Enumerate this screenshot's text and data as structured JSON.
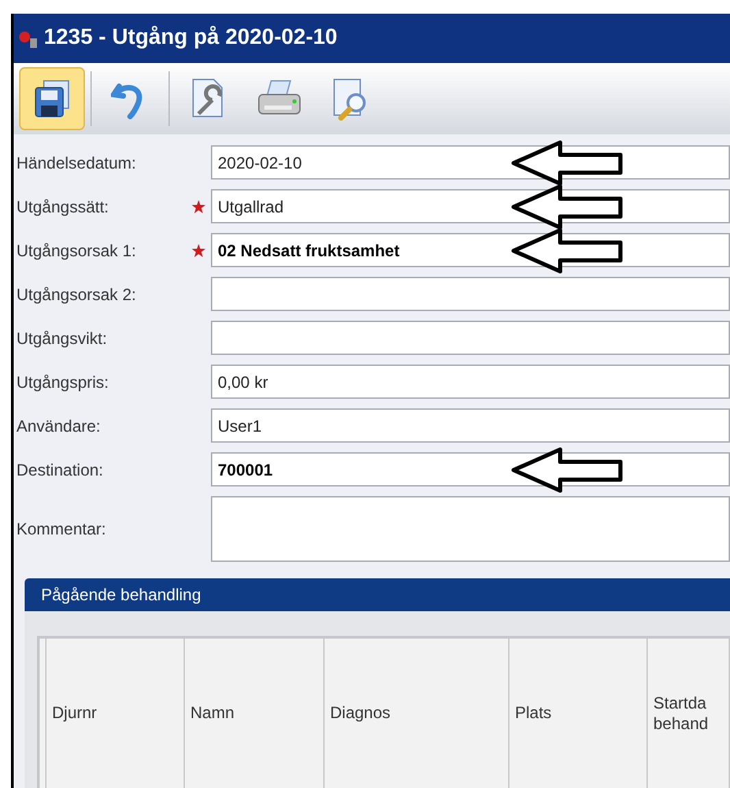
{
  "window": {
    "title": "1235 - Utgång på 2020-02-10"
  },
  "toolbar": [
    {
      "kind": "save",
      "selected": true
    },
    {
      "kind": "undo",
      "selected": false
    },
    {
      "kind": "settings",
      "selected": false
    },
    {
      "kind": "print",
      "selected": false
    },
    {
      "kind": "preview",
      "selected": false
    }
  ],
  "fields": [
    {
      "label": "Händelsedatum:",
      "value": "2020-02-10",
      "required": false,
      "bold": false,
      "annotated": true
    },
    {
      "label": "Utgångssätt:",
      "value": "Utgallrad",
      "required": true,
      "bold": false,
      "annotated": true
    },
    {
      "label": "Utgångsorsak 1:",
      "value": "02 Nedsatt fruktsamhet",
      "required": true,
      "bold": true,
      "annotated": true
    },
    {
      "label": "Utgångsorsak 2:",
      "required": false,
      "annotated": false
    },
    {
      "label": "Utgångsvikt:",
      "required": false,
      "annotated": false
    },
    {
      "label": "Utgångspris:",
      "value": "0,00 kr",
      "required": false,
      "bold": false,
      "annotated": false
    },
    {
      "label": "Användare:",
      "value": "User1",
      "required": false,
      "bold": false,
      "annotated": false
    },
    {
      "label": "Destination:",
      "value": "700001",
      "required": false,
      "bold": true,
      "annotated": true
    },
    {
      "label": "Kommentar:",
      "required": false,
      "annotated": false,
      "multiline": true
    }
  ],
  "group": {
    "title": "Pågående behandling",
    "columns": [
      "Djurnr",
      "Namn",
      "Diagnos",
      "Plats",
      "Startda\nbehand"
    ]
  }
}
